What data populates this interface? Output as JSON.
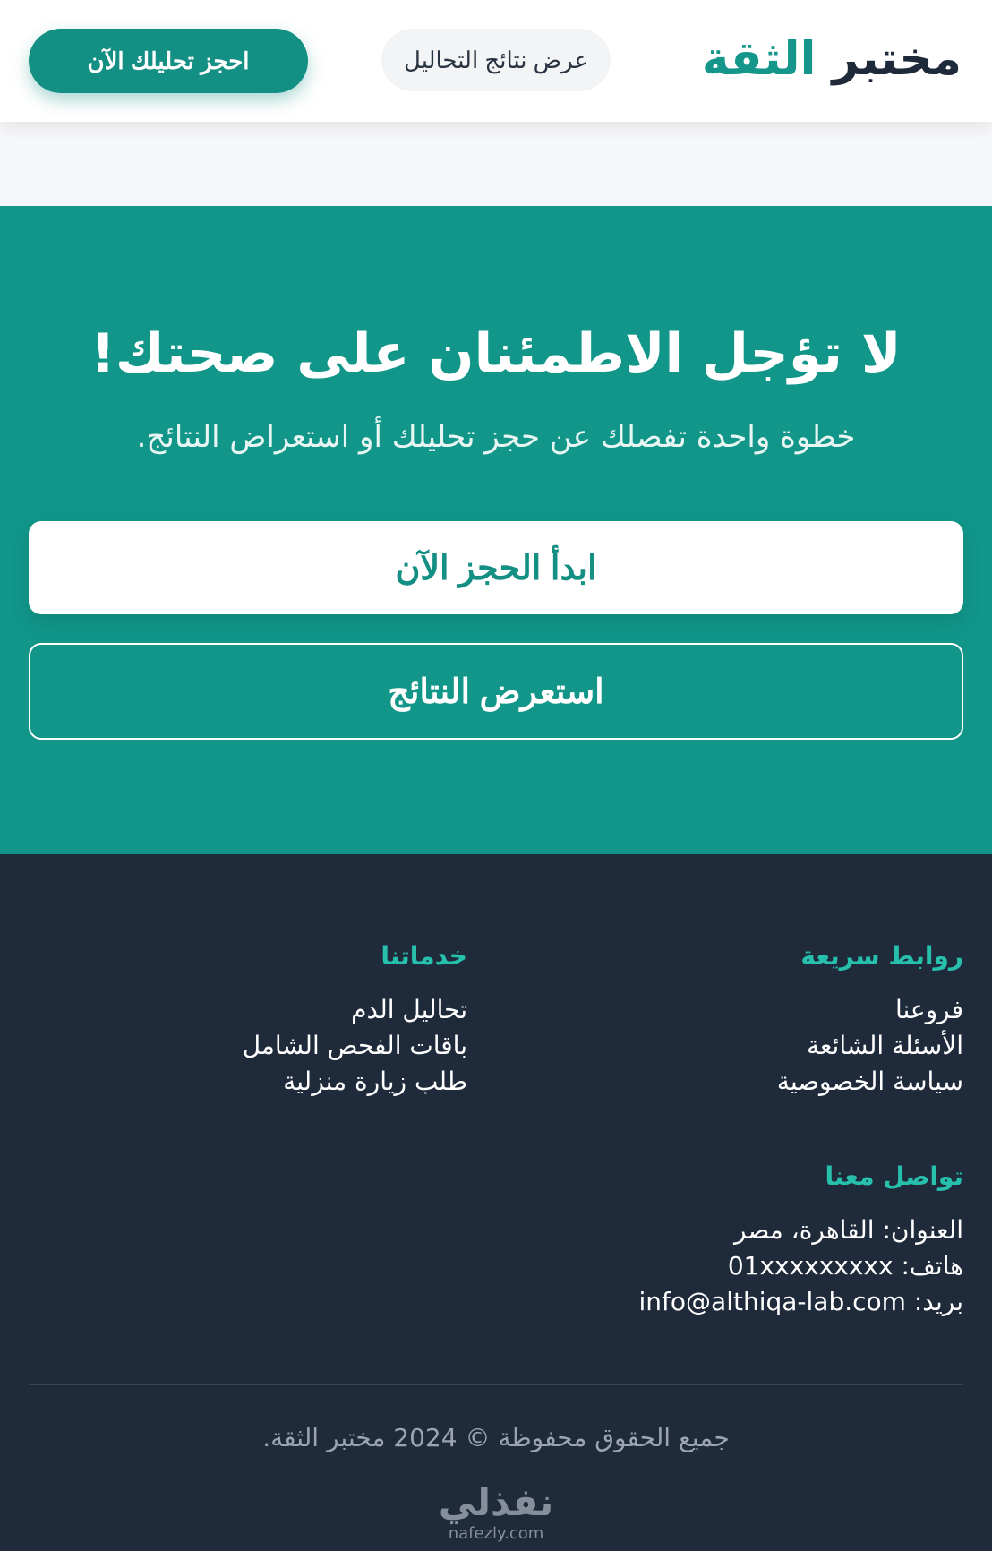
{
  "header": {
    "logo_part1": "مختبر",
    "logo_part2": "الثقة",
    "results_button": "عرض نتائج التحاليل",
    "book_button": "احجز تحليلك الآن"
  },
  "cta": {
    "title": "لا تؤجل الاطمئنان على صحتك!",
    "subtitle": "خطوة واحدة تفصلك عن حجز تحليلك أو استعراض النتائج.",
    "primary_button": "ابدأ الحجز الآن",
    "secondary_button": "استعرض النتائج"
  },
  "footer": {
    "quick_links": {
      "title": "روابط سريعة",
      "items": [
        "فروعنا",
        "الأسئلة الشائعة",
        "سياسة الخصوصية"
      ]
    },
    "services": {
      "title": "خدماتنا",
      "items": [
        "تحاليل الدم",
        "باقات الفحص الشامل",
        "طلب زيارة منزلية"
      ]
    },
    "contact": {
      "title": "تواصل معنا",
      "address": "العنوان: القاهرة، مصر",
      "phone_label": "هاتف:",
      "phone": "01xxxxxxxxx",
      "email_label": "بريد:",
      "email": "info@althiqa-lab.com"
    },
    "copyright": "جميع الحقوق محفوظة © 2024 مختبر الثقة."
  },
  "watermark": {
    "arabic": "نفذلي",
    "latin": "nafezly.com"
  },
  "colors": {
    "primary": "#12968a",
    "accent_text": "#27c0ad",
    "footer_bg": "#1f2a3a",
    "dark_text": "#1e2a3a"
  }
}
